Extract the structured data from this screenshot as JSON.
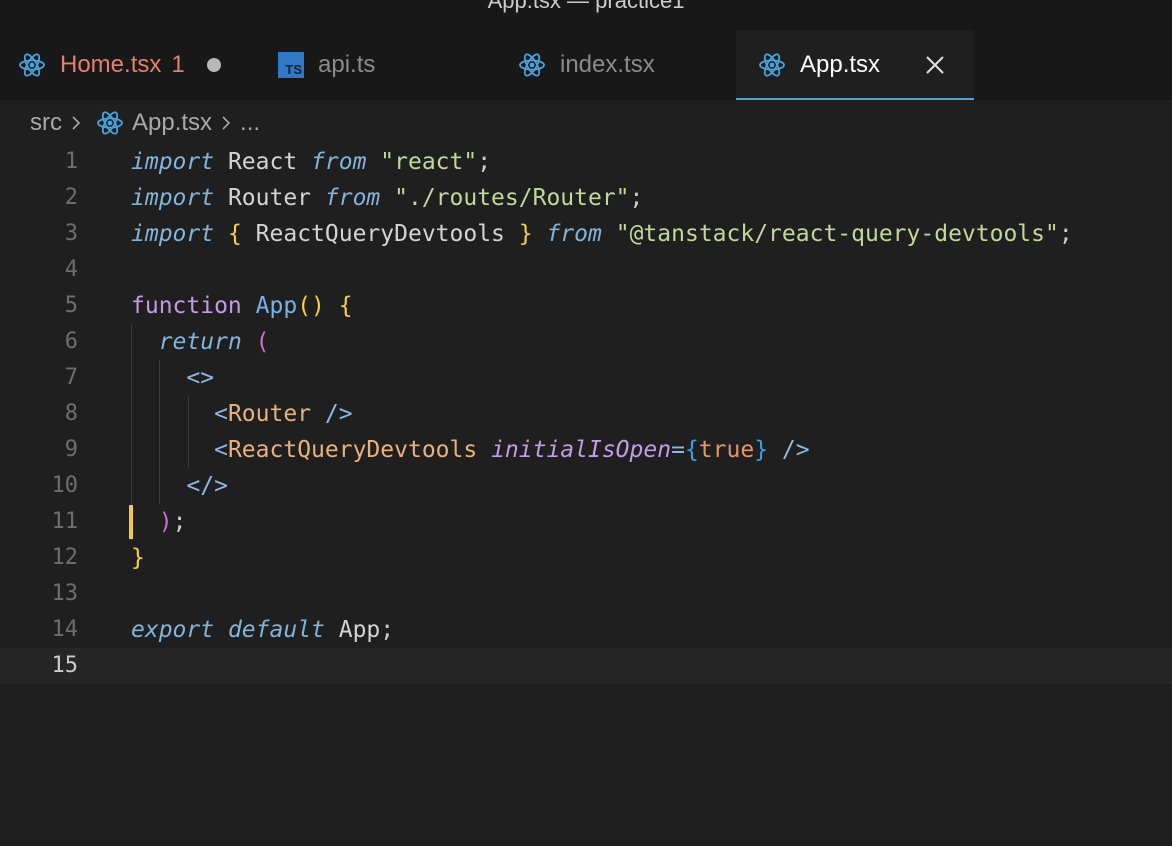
{
  "window": {
    "title": "App.tsx — practice1"
  },
  "tabs": [
    {
      "label": "Home.tsx",
      "badge": "1",
      "icon": "react-icon",
      "state": "modified-unsaved"
    },
    {
      "label": "api.ts",
      "icon": "typescript-icon",
      "icon_text": "TS",
      "state": "inactive"
    },
    {
      "label": "index.tsx",
      "icon": "react-icon",
      "state": "inactive"
    },
    {
      "label": "App.tsx",
      "icon": "react-icon",
      "state": "active"
    }
  ],
  "breadcrumb": {
    "folder": "src",
    "file": "App.tsx",
    "more": "..."
  },
  "editor": {
    "line_numbers": [
      "1",
      "2",
      "3",
      "4",
      "5",
      "6",
      "7",
      "8",
      "9",
      "10",
      "11",
      "12",
      "13",
      "14",
      "15"
    ],
    "current_line": "15",
    "lines": [
      [
        [
          "kw-i",
          "import"
        ],
        [
          "id",
          " React "
        ],
        [
          "kw-i",
          "from"
        ],
        [
          "id",
          " "
        ],
        [
          "str",
          "\"react\""
        ],
        [
          "punc",
          ";"
        ]
      ],
      [
        [
          "kw-i",
          "import"
        ],
        [
          "id",
          " Router "
        ],
        [
          "kw-i",
          "from"
        ],
        [
          "id",
          " "
        ],
        [
          "str",
          "\"./routes/Router\""
        ],
        [
          "punc",
          ";"
        ]
      ],
      [
        [
          "kw-i",
          "import"
        ],
        [
          "id",
          " "
        ],
        [
          "br1",
          "{"
        ],
        [
          "id",
          " ReactQueryDevtools "
        ],
        [
          "br1",
          "}"
        ],
        [
          "id",
          " "
        ],
        [
          "kw-i",
          "from"
        ],
        [
          "id",
          " "
        ],
        [
          "str",
          "\"@tanstack/react-query-devtools\""
        ],
        [
          "punc",
          ";"
        ]
      ],
      [],
      [
        [
          "kw-p",
          "function"
        ],
        [
          "id",
          " "
        ],
        [
          "fn",
          "App"
        ],
        [
          "br1",
          "()"
        ],
        [
          "id",
          " "
        ],
        [
          "br1",
          "{"
        ]
      ],
      [
        [
          "id",
          "  "
        ],
        [
          "kw-i",
          "return"
        ],
        [
          "id",
          " "
        ],
        [
          "br2",
          "("
        ]
      ],
      [
        [
          "id",
          "    "
        ],
        [
          "tagp",
          "<>"
        ]
      ],
      [
        [
          "id",
          "      "
        ],
        [
          "tagp",
          "<"
        ],
        [
          "tag",
          "Router"
        ],
        [
          "id",
          " "
        ],
        [
          "tagp",
          "/>"
        ]
      ],
      [
        [
          "id",
          "      "
        ],
        [
          "tagp",
          "<"
        ],
        [
          "tag",
          "ReactQueryDevtools"
        ],
        [
          "id",
          " "
        ],
        [
          "attr",
          "initialIsOpen"
        ],
        [
          "tagp",
          "="
        ],
        [
          "br3",
          "{"
        ],
        [
          "bool",
          "true"
        ],
        [
          "br3",
          "}"
        ],
        [
          "id",
          " "
        ],
        [
          "tagp",
          "/>"
        ]
      ],
      [
        [
          "id",
          "    "
        ],
        [
          "tagp",
          "</>"
        ]
      ],
      [
        [
          "id",
          "  "
        ],
        [
          "br2",
          ")"
        ],
        [
          "punc",
          ";"
        ]
      ],
      [
        [
          "br1",
          "}"
        ]
      ],
      [],
      [
        [
          "kw-i",
          "export"
        ],
        [
          "id",
          " "
        ],
        [
          "kw-i",
          "default"
        ],
        [
          "id",
          " App"
        ],
        [
          "punc",
          ";"
        ]
      ],
      []
    ]
  },
  "colors": {
    "background": "#1f1f1f",
    "tabbar": "#181818",
    "active_tab_underline": "#4fa3d9",
    "cursor": "#f2c94c",
    "modified_tab_text": "#e67e6e",
    "react_icon": "#4aa3df"
  }
}
